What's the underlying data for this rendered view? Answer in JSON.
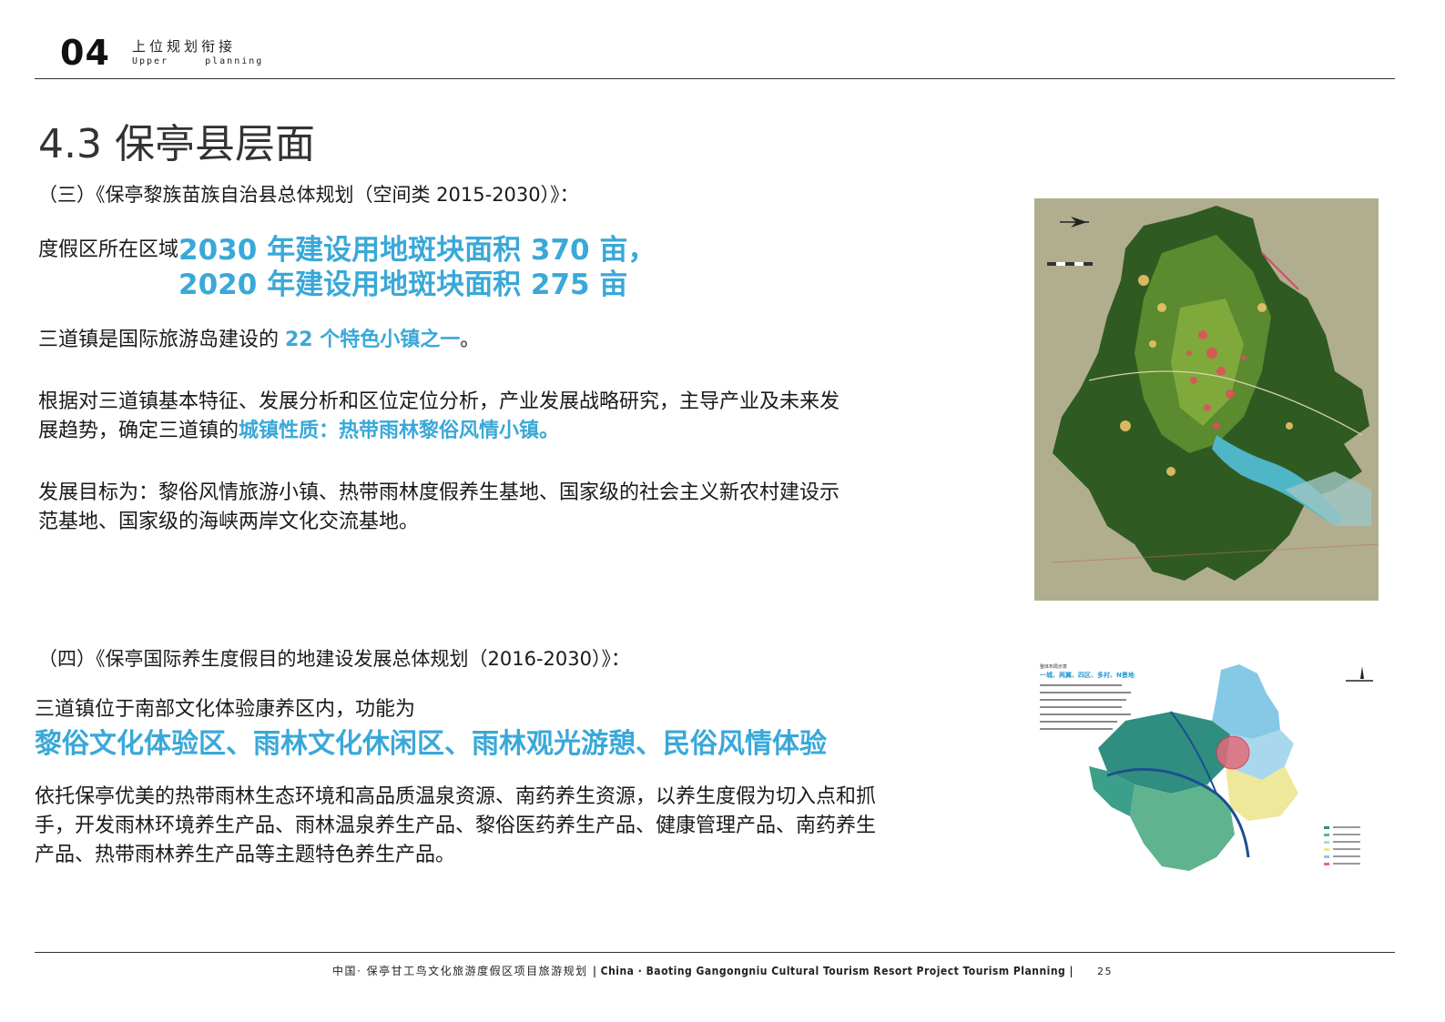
{
  "header": {
    "chapter_number": "04",
    "chapter_title_cn": "上位规划衔接",
    "chapter_title_en_1": "Upper",
    "chapter_title_en_2": "planning"
  },
  "section_title": "4.3 保亭县层面",
  "part3": {
    "heading": "（三）《保亭黎族苗族自治县总体规划（空间类 2015-2030）》：",
    "area_prefix": "度假区所在区域 ",
    "area_line1": "2030 年建设用地斑块面积 370 亩，",
    "area_line2": "2020 年建设用地斑块面积 275 亩",
    "town_prefix": "三道镇是国际旅游岛建设的 ",
    "town_highlight": "22 个特色小镇之一",
    "town_suffix": "。",
    "nature_text": "根据对三道镇基本特征、发展分析和区位定位分析，产业发展战略研究，主导产业及未来发展趋势，确定三道镇的",
    "nature_highlight": "城镇性质：热带雨林黎俗风情小镇。",
    "goal_text": "发展目标为：黎俗风情旅游小镇、热带雨林度假养生基地、国家级的社会主义新农村建设示范基地、国家级的海峡两岸文化交流基地。"
  },
  "part4": {
    "heading": "（四）《保亭国际养生度假目的地建设发展总体规划（2016-2030）》：",
    "zone_text": "三道镇位于南部文化体验康养区内，功能为",
    "zone_highlight": "黎俗文化体验区、雨林文化休闲区、雨林观光游憩、民俗风情体验",
    "rely_text": "依托保亭优美的热带雨林生态环境和高品质温泉资源、南药养生资源，以养生度假为切入点和抓手，开发雨林环境养生产品、雨林温泉养生产品、黎俗医药养生产品、健康管理产品、南药养生产品、热带雨林养生产品等主题特色养生产品。"
  },
  "images": {
    "map1_icon": "land-use-map-icon",
    "map2_icon": "zoning-map-icon",
    "map2_legend_title": "一城、两翼、四区、多村、N景地"
  },
  "footer": {
    "cn": "中国· 保亭甘工鸟文化旅游度假区项目旅游规划 ",
    "en": "| China · Baoting Gangongniu Cultural Tourism Resort Project Tourism Planning |",
    "page": "25"
  },
  "colors": {
    "accent": "#3aa8d8",
    "text": "#1a1a1a"
  }
}
